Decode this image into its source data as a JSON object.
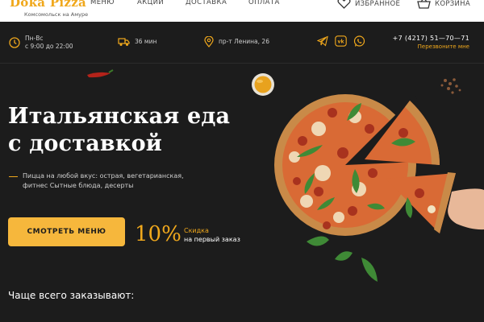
{
  "brand": {
    "name": "Doka Pizza",
    "subtitle": "Комсомольск на Амуре"
  },
  "nav": {
    "items": [
      {
        "label": "МЕНЮ"
      },
      {
        "label": "АКЦИИ"
      },
      {
        "label": "ДОСТАВКА"
      },
      {
        "label": "ОПЛАТА"
      }
    ],
    "favorites_label": "ИЗБРАННОЕ",
    "cart_label": "КОРЗИНА"
  },
  "info": {
    "hours_days": "Пн-Вс",
    "hours_time": "с 9:00 до 22:00",
    "delivery_time": "36 мин",
    "address": "пр-т Ленина, 26",
    "phone": "+7 (4217) 51—70—71",
    "callback": "Перезвоните мне",
    "social_icons": [
      "telegram-icon",
      "vk-icon",
      "whatsapp-icon"
    ]
  },
  "hero": {
    "title_line1": "Итальянская еда",
    "title_line2": "с доставкой",
    "description": "Пицца на любой вкус: острая, вегетарианская, фитнес Сытные блюда, десерты",
    "button_label": "СМОТРЕТЬ МЕНЮ",
    "discount_value": "10%",
    "discount_line1": "Скидка",
    "discount_line2": "на первый заказ"
  },
  "popular_heading": "Чаще всего заказывают:",
  "colors": {
    "accent": "#f0a81c",
    "background": "#1c1c1c",
    "button": "#f6b73c"
  }
}
